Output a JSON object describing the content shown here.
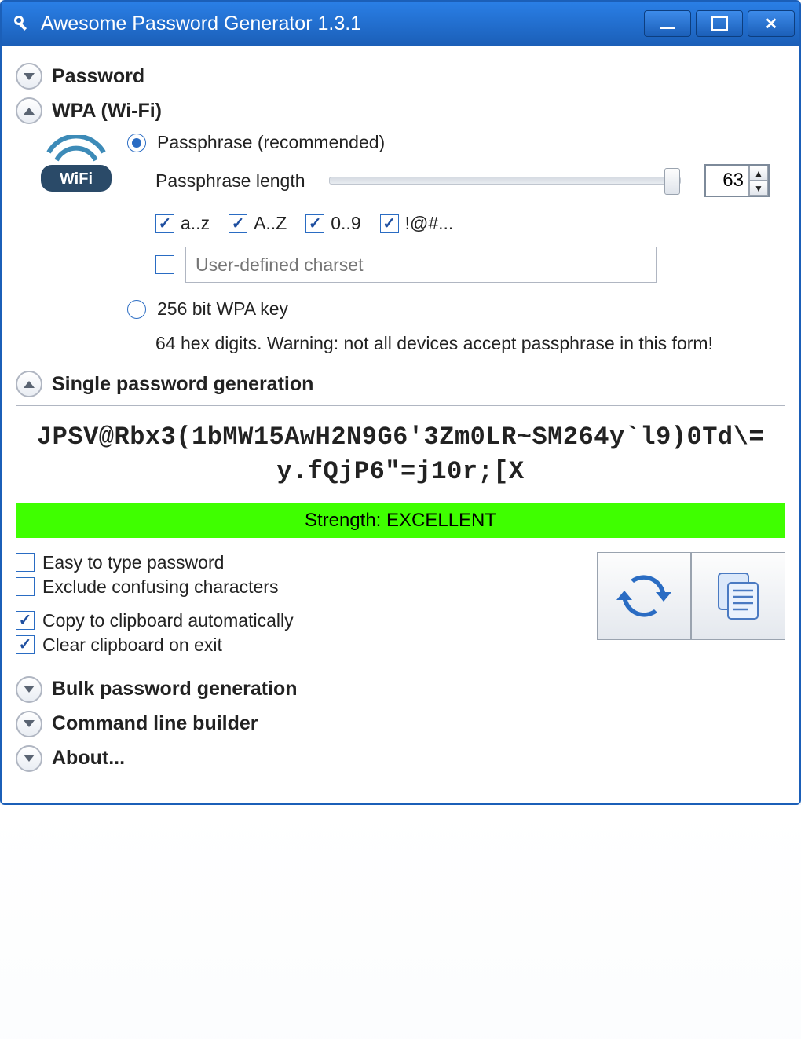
{
  "window": {
    "title": "Awesome Password Generator 1.3.1"
  },
  "sections": {
    "password": "Password",
    "wpa": "WPA (Wi-Fi)",
    "single": "Single password generation",
    "bulk": "Bulk password generation",
    "cli": "Command line builder",
    "about": "About..."
  },
  "wpa": {
    "passphrase_label": "Passphrase (recommended)",
    "length_label": "Passphrase length",
    "length_value": "63",
    "charsets": {
      "az": "a..z",
      "AZ": "A..Z",
      "digits": "0..9",
      "symbols": "!@#..."
    },
    "userdef_placeholder": "User-defined charset",
    "wpakey_label": "256 bit WPA key",
    "hex_note": "64 hex digits. Warning: not all devices accept passphrase in this form!"
  },
  "generated_password": "JPSV@Rbx3(1bMW15AwH2N9G6'3Zm0LR~SM264y`l9)0Td\\=y.fQjP6\"=j10r;[X",
  "strength": "Strength: EXCELLENT",
  "options": {
    "easy": "Easy to type password",
    "exclude": "Exclude confusing characters",
    "copy": "Copy to clipboard automatically",
    "clear": "Clear clipboard on exit"
  },
  "colors": {
    "accent": "#1b5fb8",
    "strength_bg": "#3fff00"
  }
}
